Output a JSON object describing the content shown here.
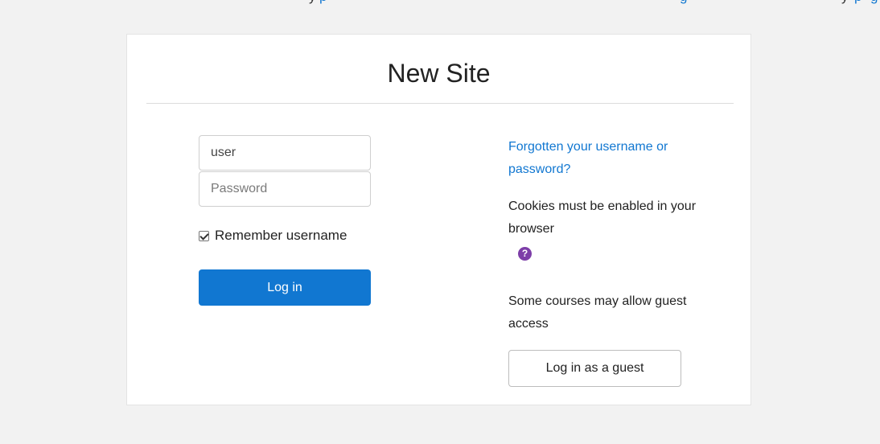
{
  "page": {
    "background": "#f2f2f2"
  },
  "header": {
    "title": "New Site"
  },
  "login_form": {
    "username_value": "user",
    "password_placeholder": "Password",
    "remember_label": "Remember username",
    "remember_checked": true,
    "login_button_label": "Log in"
  },
  "sidebar_info": {
    "forgot_link": "Forgotten your username or password?",
    "cookies_text": "Cookies must be enabled in your browser",
    "help_icon": "question-circle-icon",
    "guest_text": "Some courses may allow guest access",
    "guest_button_label": "Log in as a guest"
  },
  "colors": {
    "primary": "#1177d1",
    "help_icon": "#7d3ea8",
    "link": "#1177d1"
  }
}
